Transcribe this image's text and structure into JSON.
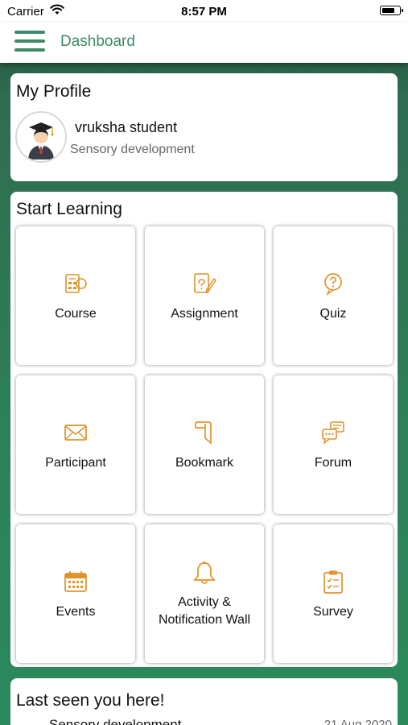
{
  "status_bar": {
    "carrier": "Carrier",
    "time": "8:57 PM"
  },
  "nav": {
    "title": "Dashboard"
  },
  "profile": {
    "title": "My Profile",
    "name": "vruksha student",
    "subtitle": "Sensory development"
  },
  "learning": {
    "title": "Start Learning",
    "tiles": [
      {
        "label": "Course",
        "icon": "course-icon"
      },
      {
        "label": "Assignment",
        "icon": "assignment-icon"
      },
      {
        "label": "Quiz",
        "icon": "quiz-icon"
      },
      {
        "label": "Participant",
        "icon": "envelope-icon"
      },
      {
        "label": "Bookmark",
        "icon": "bookmark-icon"
      },
      {
        "label": "Forum",
        "icon": "chat-bubbles-icon"
      },
      {
        "label": "Events",
        "icon": "calendar-icon"
      },
      {
        "label": "Activity &",
        "label2": "Notification Wall",
        "icon": "bell-icon"
      },
      {
        "label": "Survey",
        "icon": "clipboard-icon"
      }
    ]
  },
  "last_seen": {
    "title": "Last seen you here!",
    "item": "Sensory development",
    "date": "21 Aug 2020"
  },
  "colors": {
    "accent": "#3d8a68",
    "icon": "#e0922b"
  }
}
